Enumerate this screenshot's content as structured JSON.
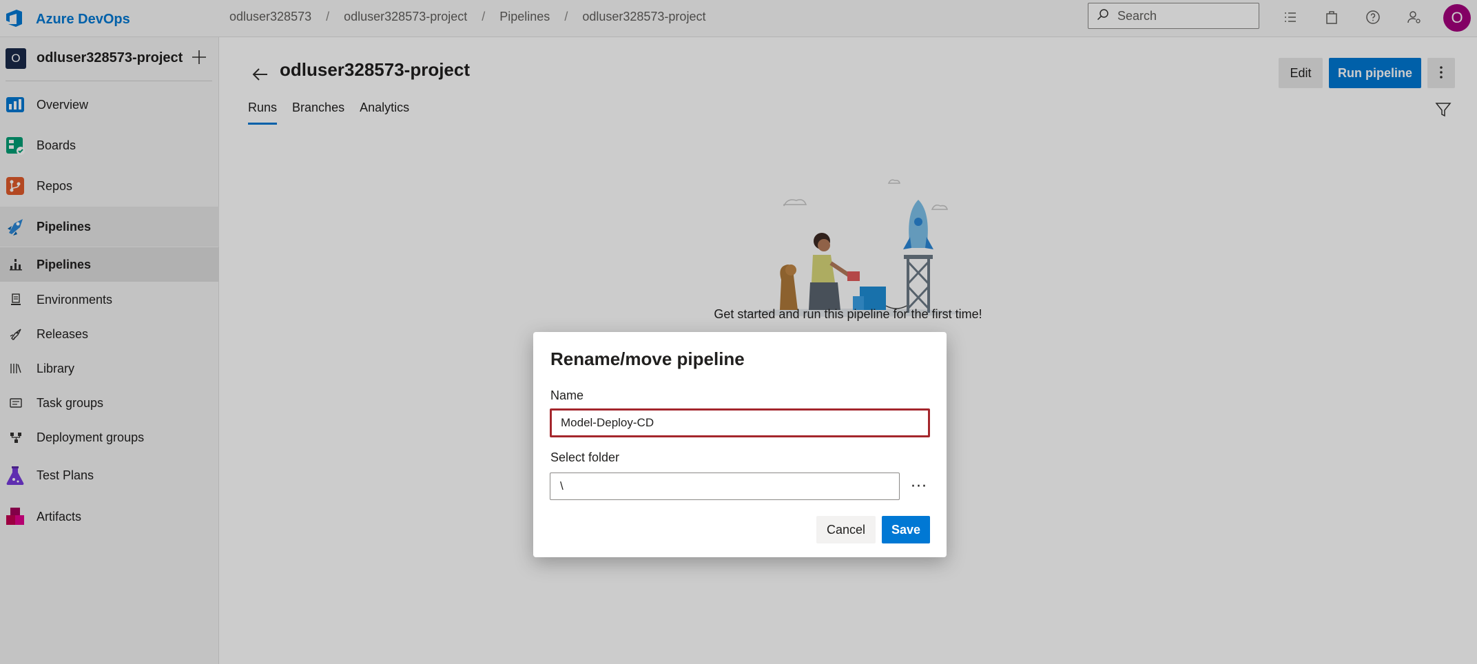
{
  "brand": {
    "name": "Azure DevOps"
  },
  "breadcrumb": [
    "odluser328573",
    "odluser328573-project",
    "Pipelines",
    "odluser328573-project"
  ],
  "search": {
    "placeholder": "Search"
  },
  "user": {
    "initial": "O",
    "color": "#a4007d"
  },
  "colors": {
    "accent": "#0078d4",
    "error_border": "#a4262c"
  },
  "sidebar": {
    "project": {
      "initial": "O",
      "name": "odluser328573-project"
    },
    "items": [
      {
        "label": "Overview",
        "icon": "overview-icon"
      },
      {
        "label": "Boards",
        "icon": "boards-icon"
      },
      {
        "label": "Repos",
        "icon": "repos-icon"
      },
      {
        "label": "Pipelines",
        "icon": "pipelines-icon"
      },
      {
        "label": "Pipelines",
        "icon": "pipelines-sub-icon"
      },
      {
        "label": "Environments",
        "icon": "environments-icon"
      },
      {
        "label": "Releases",
        "icon": "releases-icon"
      },
      {
        "label": "Library",
        "icon": "library-icon"
      },
      {
        "label": "Task groups",
        "icon": "task-groups-icon"
      },
      {
        "label": "Deployment groups",
        "icon": "deployment-groups-icon"
      },
      {
        "label": "Test Plans",
        "icon": "test-plans-icon"
      },
      {
        "label": "Artifacts",
        "icon": "artifacts-icon"
      }
    ]
  },
  "main": {
    "title": "odluser328573-project",
    "edit_label": "Edit",
    "run_label": "Run pipeline",
    "tabs": [
      "Runs",
      "Branches",
      "Analytics"
    ],
    "empty_message": "Get started and run this pipeline for the first time!"
  },
  "dialog": {
    "title": "Rename/move pipeline",
    "name_label": "Name",
    "name_value": "Model-Deploy-CD",
    "folder_label": "Select folder",
    "folder_value": "\\",
    "browse_label": "···",
    "cancel_label": "Cancel",
    "save_label": "Save"
  }
}
